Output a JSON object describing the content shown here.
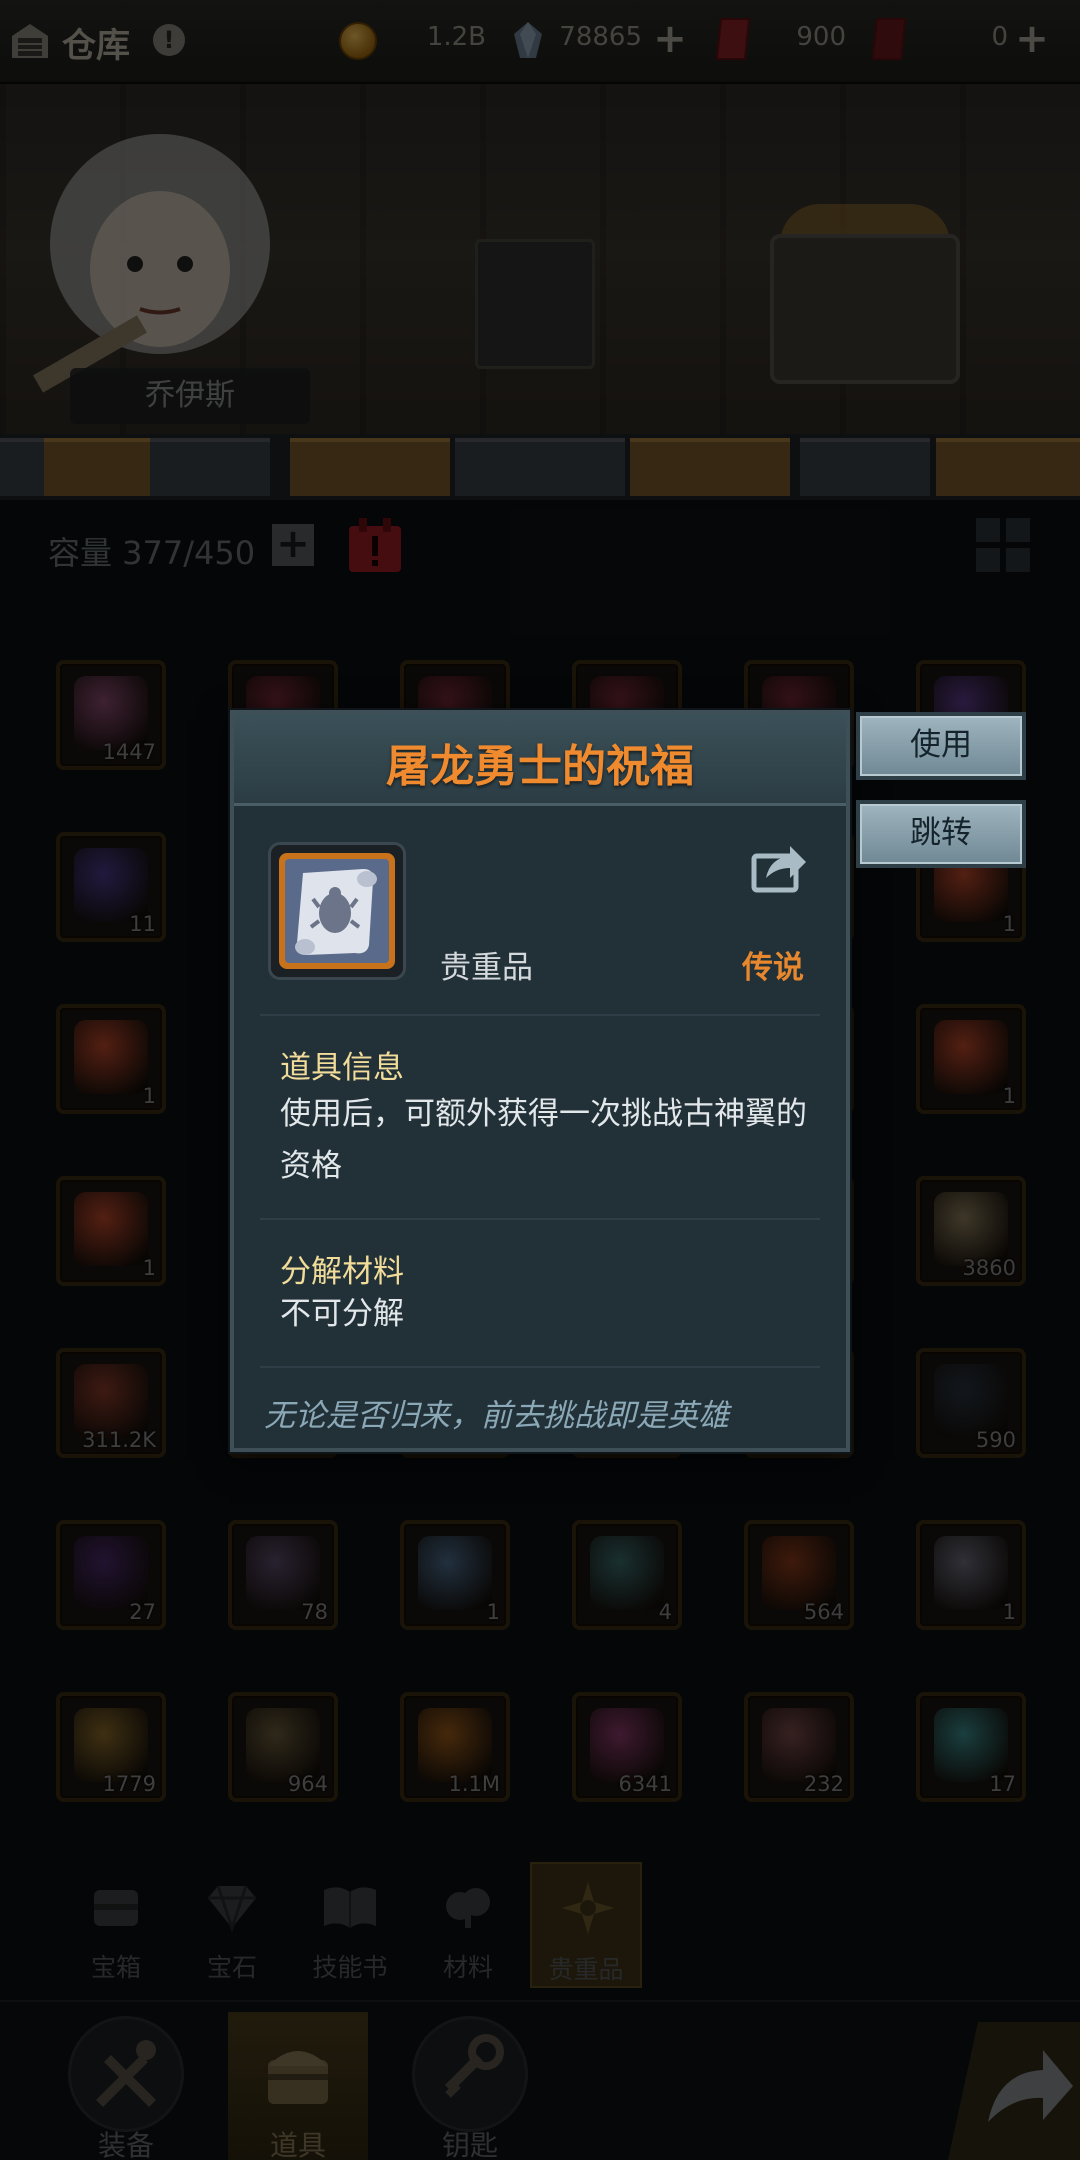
{
  "topbar": {
    "title": "仓库",
    "help": "!",
    "gold": "1.2B",
    "crystal": "78865",
    "ticket_red": "900",
    "ticket_dark": "0"
  },
  "scene": {
    "hero_name": "乔伊斯"
  },
  "capacity": {
    "label": "容量 377/450"
  },
  "grid_rows": [
    [
      {
        "qty": "1447",
        "color": "#8a4a70"
      },
      {
        "qty": "",
        "color": "#7a2a3a"
      },
      {
        "qty": "",
        "color": "#7a2a3a"
      },
      {
        "qty": "",
        "color": "#7a2a3a"
      },
      {
        "qty": "",
        "color": "#7a2a3a"
      },
      {
        "qty": "",
        "color": "#5a3a8a"
      }
    ],
    [
      {
        "qty": "11",
        "color": "#4a3a8a"
      },
      {
        "qty": "",
        "color": "#2a2a2a"
      },
      {
        "qty": "",
        "color": "#2a2a2a"
      },
      {
        "qty": "",
        "color": "#2a2a2a"
      },
      {
        "qty": "",
        "color": "#2a2a2a"
      },
      {
        "qty": "1",
        "color": "#b8462a"
      }
    ],
    [
      {
        "qty": "1",
        "color": "#b8462a"
      },
      {
        "qty": "",
        "color": "#2a2a2a"
      },
      {
        "qty": "",
        "color": "#2a2a2a"
      },
      {
        "qty": "",
        "color": "#2a2a2a"
      },
      {
        "qty": "",
        "color": "#2a2a2a"
      },
      {
        "qty": "1",
        "color": "#b8462a"
      }
    ],
    [
      {
        "qty": "1",
        "color": "#b8462a"
      },
      {
        "qty": "",
        "color": "#2a2a2a"
      },
      {
        "qty": "",
        "color": "#2a2a2a"
      },
      {
        "qty": "",
        "color": "#2a2a2a"
      },
      {
        "qty": "",
        "color": "#2a2a2a"
      },
      {
        "qty": "3860",
        "color": "#8a7a5a"
      }
    ],
    [
      {
        "qty": "311.2K",
        "color": "#8a3a2a"
      },
      {
        "qty": "",
        "color": "#2a2a2a"
      },
      {
        "qty": "",
        "color": "#2a2a2a"
      },
      {
        "qty": "",
        "color": "#2a2a2a"
      },
      {
        "qty": "",
        "color": "#2a2a2a"
      },
      {
        "qty": "590",
        "color": "#2a3440"
      }
    ],
    [
      {
        "qty": "27",
        "color": "#4a2a6a"
      },
      {
        "qty": "78",
        "color": "#5a4a6a"
      },
      {
        "qty": "1",
        "color": "#4a6a8a"
      },
      {
        "qty": "4",
        "color": "#3a6a6a"
      },
      {
        "qty": "564",
        "color": "#8a3a1a"
      },
      {
        "qty": "1",
        "color": "#6a6a7a"
      }
    ],
    [
      {
        "qty": "1779",
        "color": "#8a6a2a"
      },
      {
        "qty": "964",
        "color": "#6a5a3a"
      },
      {
        "qty": "1.1M",
        "color": "#9a5a1a"
      },
      {
        "qty": "6341",
        "color": "#8a3a6a"
      },
      {
        "qty": "232",
        "color": "#7a4a4a"
      },
      {
        "qty": "17",
        "color": "#3a8a8a"
      }
    ]
  ],
  "categories": [
    {
      "label": "宝箱",
      "icon": "chest-icon",
      "active": false
    },
    {
      "label": "宝石",
      "icon": "diamond-icon",
      "active": false
    },
    {
      "label": "技能书",
      "icon": "book-icon",
      "active": false
    },
    {
      "label": "材料",
      "icon": "material-icon",
      "active": false
    },
    {
      "label": "贵重品",
      "icon": "valuable-icon",
      "active": true
    }
  ],
  "bottom_nav": [
    {
      "label": "装备",
      "active": false
    },
    {
      "label": "道具",
      "active": true
    },
    {
      "label": "钥匙",
      "active": false
    }
  ],
  "modal": {
    "title": "屠龙勇士的祝福",
    "item_type": "贵重品",
    "rarity": "传说",
    "info_title": "道具信息",
    "info_body": "使用后，可额外获得一次挑战古神翼的资格",
    "decompose_title": "分解材料",
    "decompose_body": "不可分解",
    "quote": "无论是否归来，前去挑战即是英雄"
  },
  "actions": {
    "use": "使用",
    "jump": "跳转"
  },
  "colors": {
    "title_orange": "#f08a2e",
    "rarity_orange": "#e7872e",
    "section_gold": "#f1dc9a",
    "quote_blue": "#8aa8b6"
  }
}
